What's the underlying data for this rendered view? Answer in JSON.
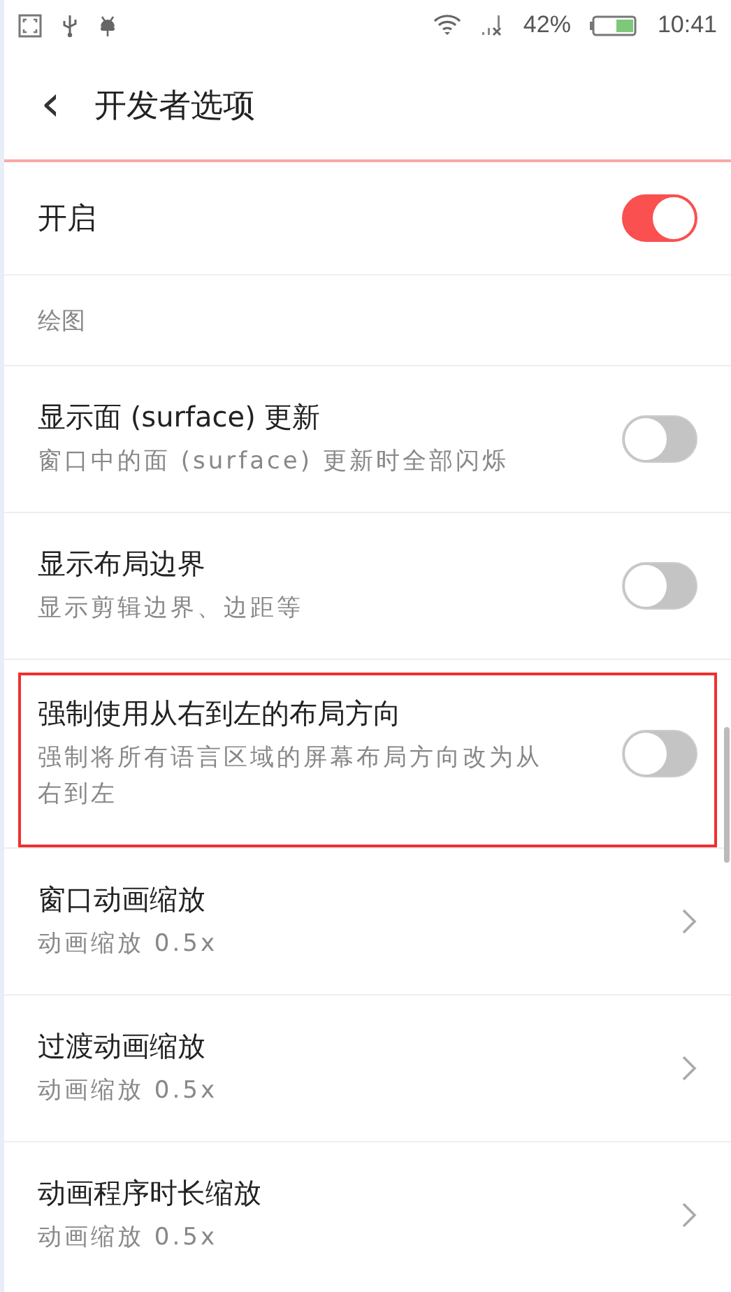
{
  "status_bar": {
    "battery_text": "42%",
    "time": "10:41"
  },
  "header": {
    "back": "‹",
    "title": "开发者选项"
  },
  "master": {
    "label": "开启",
    "on": true
  },
  "section": {
    "title": "绘图"
  },
  "items": [
    {
      "kind": "toggle",
      "title": "显示面 (surface) 更新",
      "subtitle": "窗口中的面 (surface) 更新时全部闪烁",
      "on": false,
      "highlighted": false
    },
    {
      "kind": "toggle",
      "title": "显示布局边界",
      "subtitle": "显示剪辑边界、边距等",
      "on": false,
      "highlighted": false
    },
    {
      "kind": "toggle",
      "title": "强制使用从右到左的布局方向",
      "subtitle": "强制将所有语言区域的屏幕布局方向改为从右到左",
      "on": false,
      "highlighted": true
    },
    {
      "kind": "link",
      "title": "窗口动画缩放",
      "subtitle": "动画缩放 0.5x",
      "highlighted": false
    },
    {
      "kind": "link",
      "title": "过渡动画缩放",
      "subtitle": "动画缩放 0.5x",
      "highlighted": false
    },
    {
      "kind": "link",
      "title": "动画程序时长缩放",
      "subtitle": "动画缩放 0.5x",
      "highlighted": false
    }
  ]
}
